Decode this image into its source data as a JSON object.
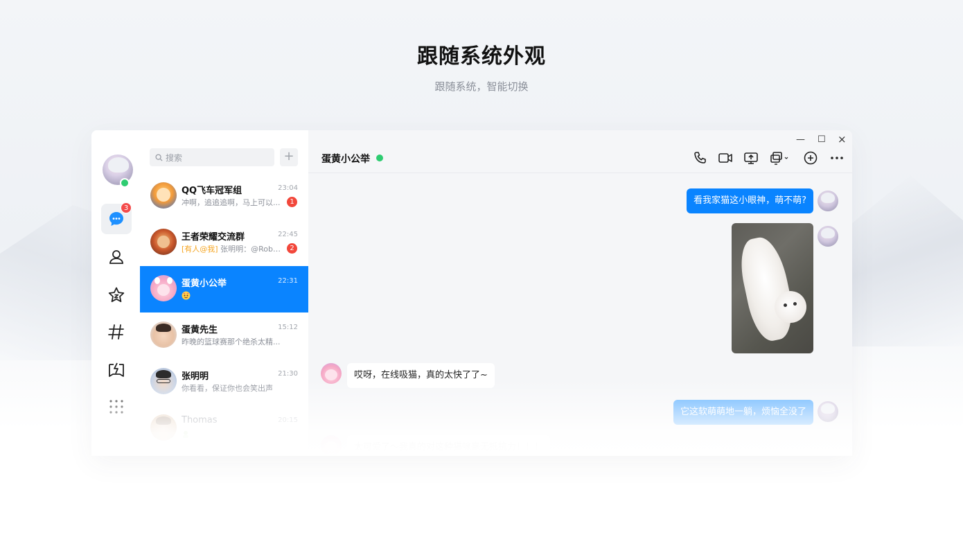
{
  "headline": {
    "title": "跟随系统外观",
    "subtitle": "跟随系统，智能切换"
  },
  "rail": {
    "message_badge": "3",
    "items": [
      "chat",
      "contacts",
      "favorites",
      "channels",
      "games",
      "more"
    ]
  },
  "search": {
    "placeholder": "搜索",
    "add_label": "+"
  },
  "conversations": [
    {
      "name": "QQ飞车冠军组",
      "time": "23:04",
      "preview_tag": "",
      "preview": "冲啊，追追追啊，马上可以...",
      "unread": "1"
    },
    {
      "name": "王者荣耀交流群",
      "time": "22:45",
      "preview_tag": "[有人@我]",
      "preview": " 张明明：@Robe...",
      "unread": "2"
    },
    {
      "name": "蛋黄小公举",
      "time": "22:31",
      "preview_tag": "",
      "preview": "",
      "unread": ""
    },
    {
      "name": "蛋黄先生",
      "time": "15:12",
      "preview_tag": "",
      "preview": "昨晚的篮球赛那个绝杀太精...",
      "unread": ""
    },
    {
      "name": "张明明",
      "time": "21:30",
      "preview_tag": "",
      "preview": "你看看，保证你也会笑出声",
      "unread": ""
    },
    {
      "name": "Thomas",
      "time": "20:15",
      "preview_tag": "",
      "preview": "",
      "unread": ""
    }
  ],
  "chat": {
    "title": "蛋黄小公举",
    "window_controls": {
      "minimize": "—",
      "maximize": "☐",
      "close": "×"
    },
    "messages": [
      {
        "from": "me",
        "text": "看我家猫这小眼神，萌不萌?"
      },
      {
        "from": "me",
        "type": "image"
      },
      {
        "from": "them",
        "text": "哎呀，在线吸猫，真的太快了了~"
      },
      {
        "from": "me",
        "text": "它这软萌萌地一躺，烦恼全没了"
      },
      {
        "from": "them",
        "text": "太可爱了～我真的对这种猫咪毫无抵抗力！！！"
      }
    ]
  },
  "colors": {
    "accent": "#0a84ff",
    "online": "#2ecc71",
    "badge": "#f2473b",
    "mention": "#f5a623"
  }
}
